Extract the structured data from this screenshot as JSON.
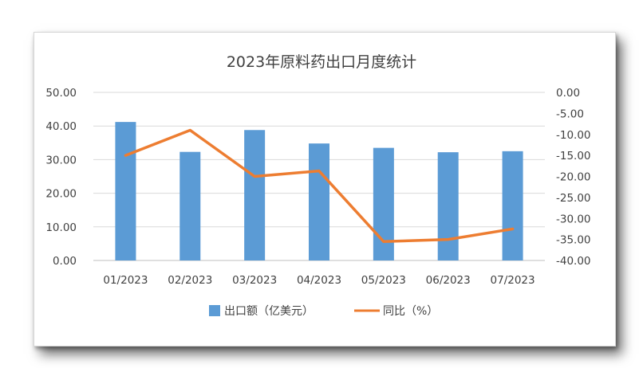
{
  "chart_data": {
    "type": "bar",
    "title": "2023年原料药出口月度统计",
    "categories": [
      "01/2023",
      "02/2023",
      "03/2023",
      "04/2023",
      "05/2023",
      "06/2023",
      "07/2023"
    ],
    "series": [
      {
        "name": "出口额（亿美元）",
        "type": "bar",
        "axis": "left",
        "color": "#5b9bd5",
        "values": [
          41.2,
          32.3,
          38.8,
          34.8,
          33.5,
          32.2,
          32.5
        ]
      },
      {
        "name": "同比（%）",
        "type": "line",
        "axis": "right",
        "color": "#ed7d31",
        "values": [
          -15.0,
          -9.0,
          -20.0,
          -18.7,
          -35.5,
          -35.0,
          -32.5
        ]
      }
    ],
    "left_axis": {
      "min": 0,
      "max": 50,
      "step": 10,
      "tick_labels": [
        "0.00",
        "10.00",
        "20.00",
        "30.00",
        "40.00",
        "50.00"
      ]
    },
    "right_axis": {
      "min": -40,
      "max": 0,
      "step": 5,
      "tick_labels": [
        "-40.00",
        "-35.00",
        "-30.00",
        "-25.00",
        "-20.00",
        "-15.00",
        "-10.00",
        "-5.00",
        "0.00"
      ]
    },
    "grid": true,
    "legend_position": "bottom"
  }
}
